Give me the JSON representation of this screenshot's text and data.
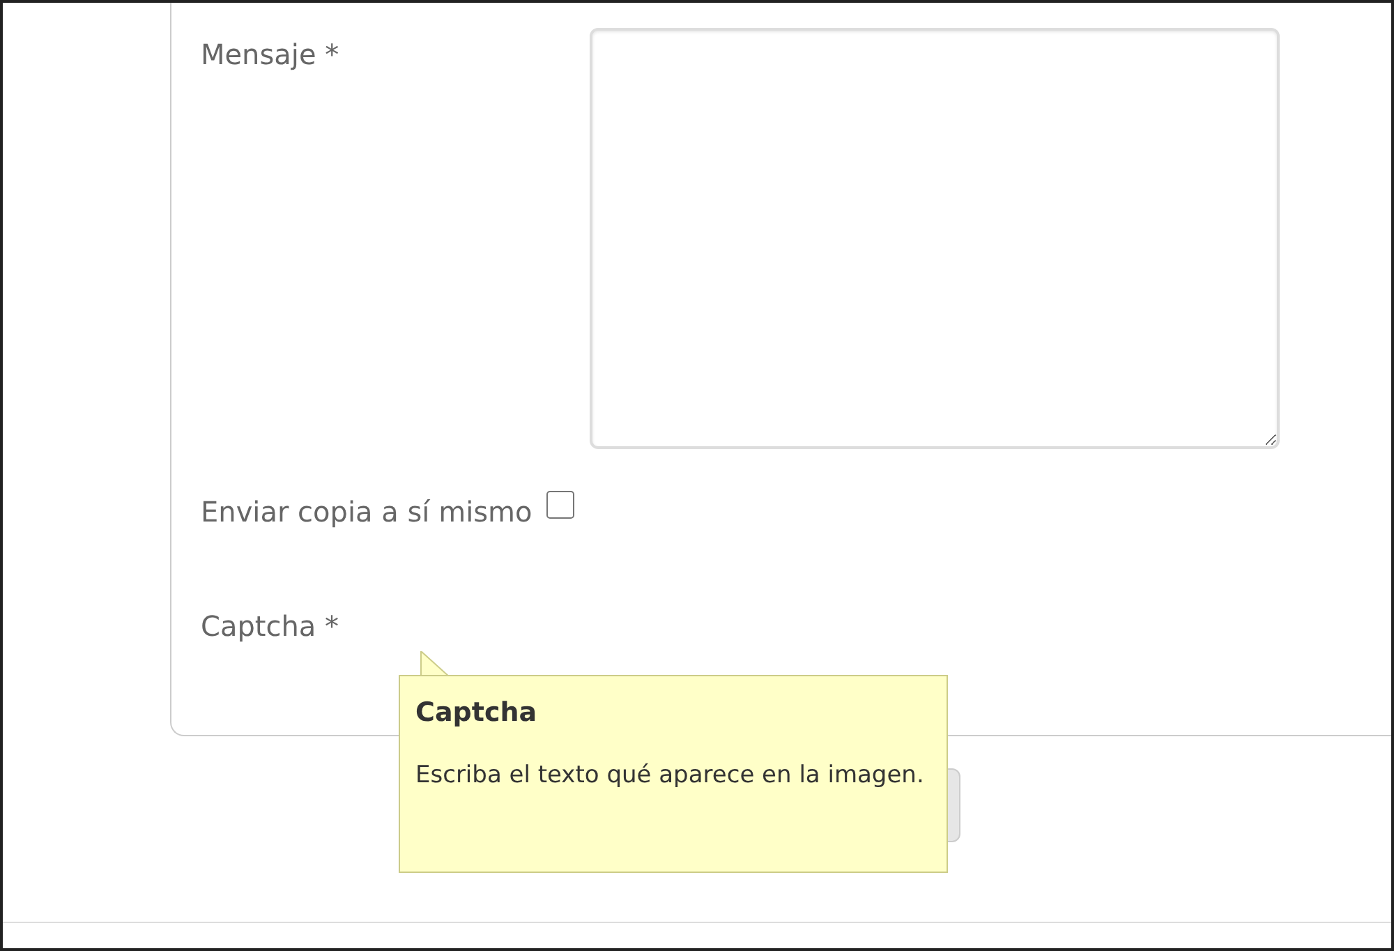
{
  "form": {
    "fields": [
      {
        "kind": "textarea",
        "label": "Mensaje *"
      },
      {
        "kind": "checkbox",
        "label": "Enviar copia a sí mismo",
        "checked": false
      },
      {
        "kind": "captcha",
        "label": "Captcha *"
      }
    ]
  },
  "tooltip": {
    "title": "Captcha",
    "text": "Escriba el texto qué aparece en la imagen."
  }
}
